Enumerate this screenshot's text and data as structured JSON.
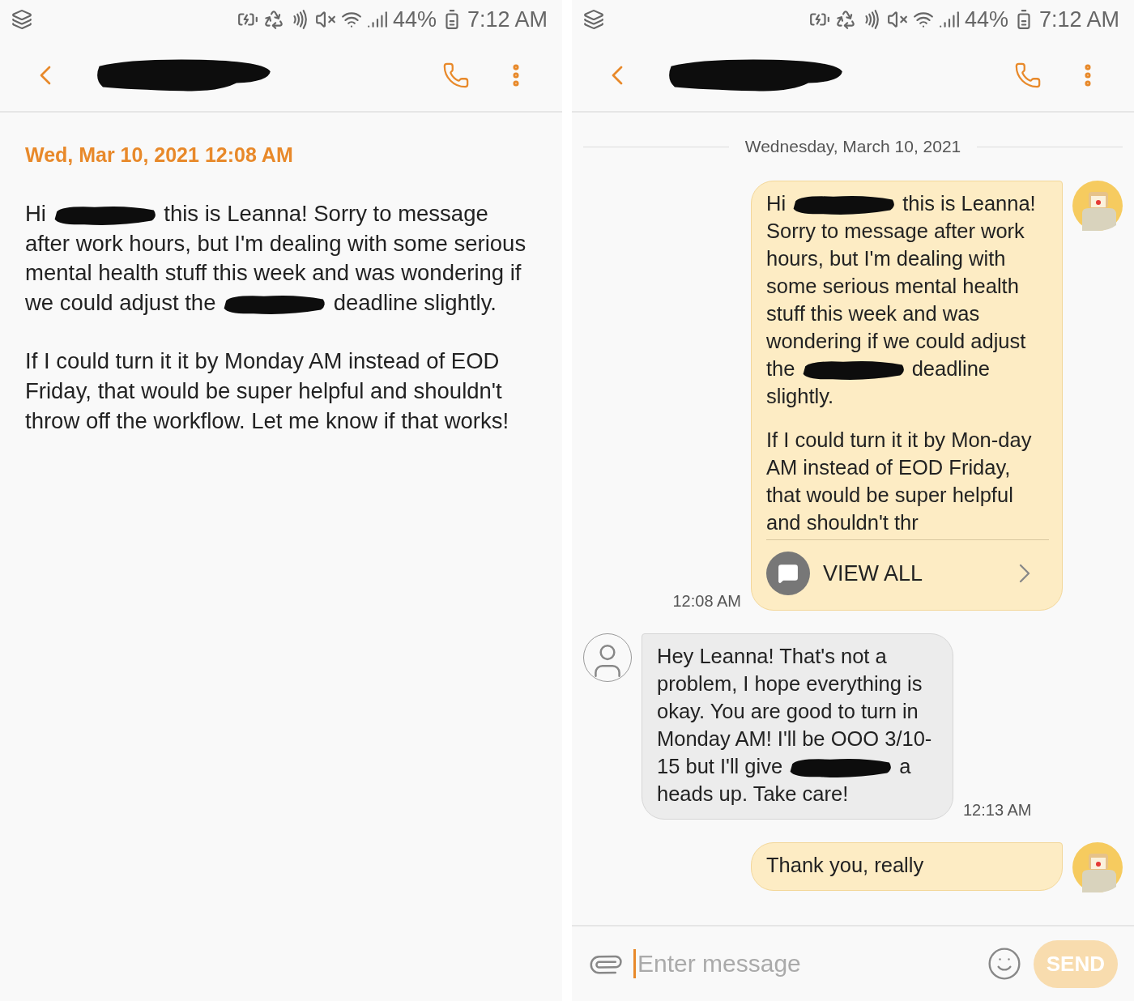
{
  "panels": [
    {
      "kind": "detail",
      "status_bar": {
        "battery": "44%",
        "time": "7:12 AM"
      },
      "date": "Wed, Mar 10, 2021 12:08 AM",
      "paragraphs": [
        [
          {
            "kind": "text",
            "text": "Hi "
          },
          {
            "kind": "redaction"
          },
          {
            "kind": "text",
            "text": " this is Leanna! Sorry to message after work hours, but I'm dealing with some serious mental health stuff this week and was wondering if we could adjust the "
          },
          {
            "kind": "redaction"
          },
          {
            "kind": "text",
            "text": " deadline slightly."
          }
        ],
        [
          {
            "kind": "text",
            "text": "If I could turn it it by Monday AM instead of EOD Friday, that would be super helpful and shouldn't throw off the workflow. Let me know if that works!"
          }
        ]
      ]
    },
    {
      "kind": "conversation",
      "status_bar": {
        "battery": "44%",
        "time": "7:12 AM"
      },
      "date_divider": "Wednesday, March 10, 2021",
      "messages": [
        {
          "kind": "sent",
          "time": "12:08 AM",
          "view_all": "VIEW ALL",
          "paragraphs": [
            [
              {
                "kind": "text",
                "text": "Hi "
              },
              {
                "kind": "redaction"
              },
              {
                "kind": "text",
                "text": " this is Leanna! Sorry to message after work hours, but I'm dealing with some serious mental health stuff this week and was wondering if we could adjust the "
              },
              {
                "kind": "redaction"
              },
              {
                "kind": "text",
                "text": " deadline slightly."
              }
            ],
            [
              {
                "kind": "text",
                "text": "If I could turn it it by Mon-day AM instead of EOD Friday, that would be super helpful and shouldn't thr"
              }
            ]
          ]
        },
        {
          "kind": "received",
          "time": "12:13 AM",
          "paragraphs": [
            [
              {
                "kind": "text",
                "text": "Hey Leanna! That's not a problem, I hope everything is okay. You are good to turn in Monday AM! I'll be OOO 3/10-15 but I'll give "
              },
              {
                "kind": "redaction"
              },
              {
                "kind": "text",
                "text": " a heads up. Take care!"
              }
            ]
          ]
        },
        {
          "kind": "sent",
          "paragraphs": [
            [
              {
                "kind": "text",
                "text": "Thank you, really"
              }
            ]
          ]
        }
      ],
      "composer": {
        "placeholder": "Enter message",
        "send": {
          "label": "SEND",
          "disabled": true
        }
      }
    }
  ]
}
